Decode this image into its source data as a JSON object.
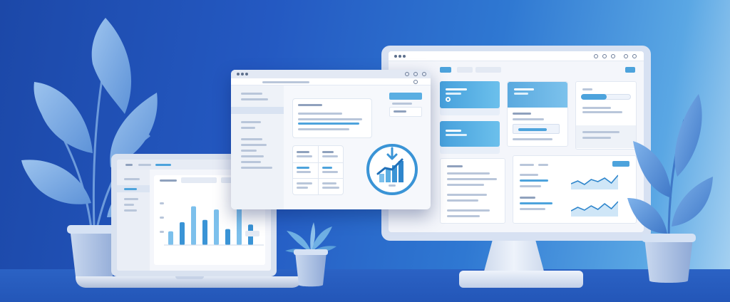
{
  "illustration": {
    "palette": {
      "background_dark": "#1c48a8",
      "background_light": "#a9d3f2",
      "accent_blue": "#4da3dc",
      "screen_white": "#f4f6fb",
      "leaf_blue": "#6fa3e0"
    },
    "laptop_chart": {
      "type": "bar",
      "values": [
        0.3,
        0.5,
        0.85,
        0.55,
        0.78,
        0.35,
        0.82,
        0.45
      ]
    },
    "badge_icon": "growth-chart-with-download-arrow-icon",
    "sparklines": [
      [
        0.3,
        0.5,
        0.25,
        0.6,
        0.45,
        0.7,
        0.35,
        0.9
      ],
      [
        0.3,
        0.55,
        0.35,
        0.65,
        0.4,
        0.8,
        0.45,
        0.95
      ]
    ]
  }
}
